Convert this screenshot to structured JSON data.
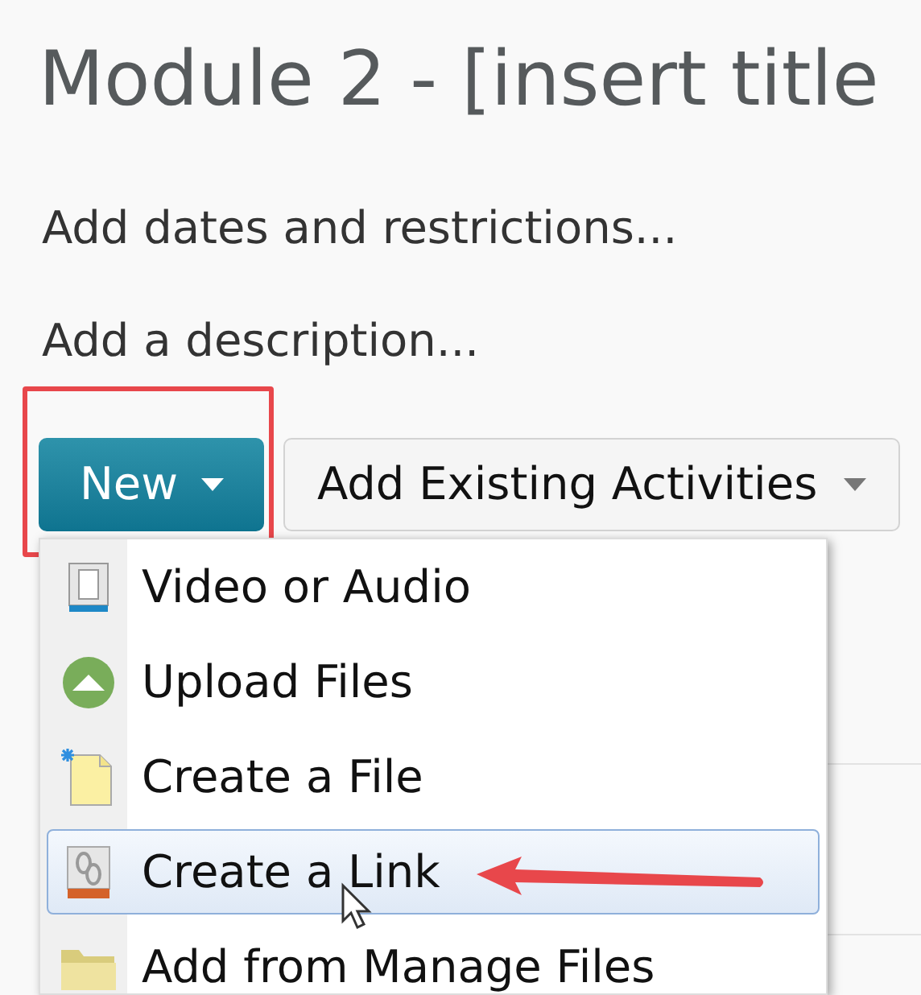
{
  "title": "Module 2 - [insert title",
  "links": [
    "Add dates and restrictions...",
    "Add a description..."
  ],
  "buttons": [
    {
      "label": "New",
      "kind": "primary",
      "highlighted": true
    },
    {
      "label": "Add Existing Activities",
      "kind": "secondary",
      "highlighted": false
    }
  ],
  "menu": [
    {
      "label": "Video or Audio",
      "kind": "video",
      "selected": false
    },
    {
      "label": "Upload Files",
      "kind": "upload",
      "selected": false
    },
    {
      "label": "Create a File",
      "kind": "file",
      "selected": false
    },
    {
      "label": "Create a Link",
      "kind": "link",
      "selected": true
    },
    {
      "label": "Add from Manage Files",
      "kind": "folder",
      "selected": false
    }
  ]
}
